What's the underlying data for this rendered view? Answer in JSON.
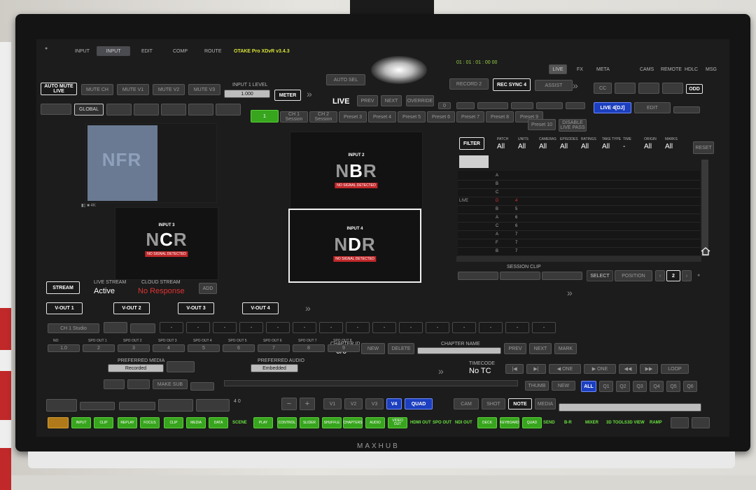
{
  "app": {
    "title": "OTAKE Pro XDvR v3.4.3",
    "brand": "MAXHUB"
  },
  "top_tabs": [
    "INPUT",
    "EDIT",
    "COMP",
    "ROUTE"
  ],
  "right_tabs": [
    "LIVE",
    "FX",
    "META",
    "CAMS",
    "REMOTE",
    "HDLC",
    "MSG"
  ],
  "header_buttons": {
    "auto_mute_live": "AUTO MUTE LIVE",
    "mute": [
      "MUTE CH",
      "MUTE V1",
      "MUTE V2",
      "MUTE V3"
    ],
    "input_level_label": "INPUT 1 LEVEL",
    "input_level": "1.000",
    "meter": "METER",
    "output": "LIVE",
    "prev": "PREV",
    "rec_sync": "REC SYNC",
    "rec_sync_val": "4",
    "assist": "ASSIST",
    "live_dj": "LIVE 4[DJ]",
    "edit": "EDIT",
    "global": "GLOBAL"
  },
  "rec_row": [
    "1",
    "CH 1 Session",
    "CH 2 Session",
    "Preset 3",
    "Preset 4",
    "Preset 5",
    "Preset 6",
    "Preset 7",
    "Preset 8",
    "Preset 9",
    "Preset 10",
    "DISABLE LIVE PASS"
  ],
  "monitors": [
    {
      "id": "NFR",
      "label": "",
      "nosig": ""
    },
    {
      "id": "NBR",
      "label": "INPUT 2",
      "nosig": "NO SIGNAL DETECTED",
      "hl": "B"
    },
    {
      "id": "NCR",
      "label": "INPUT 3",
      "nosig": "NO SIGNAL DETECTED",
      "hl": "C"
    },
    {
      "id": "NDR",
      "label": "INPUT 4",
      "nosig": "NO SIGNAL DETECTED",
      "hl": "D"
    }
  ],
  "filter": {
    "button": "FILTER",
    "columns": [
      {
        "h": "PATCH",
        "v": "All"
      },
      {
        "h": "UNITS",
        "v": "All"
      },
      {
        "h": "CAMERAS",
        "v": "All"
      },
      {
        "h": "EPISODES",
        "v": "All"
      },
      {
        "h": "RATINGS",
        "v": "All"
      },
      {
        "h": "TAKE TYPE",
        "v": "All"
      },
      {
        "h": "TIME",
        "v": "-"
      },
      {
        "h": "ORIGIN",
        "v": "All"
      },
      {
        "h": "MARKS",
        "v": "All"
      }
    ],
    "reset": "RESET"
  },
  "clip_rows": [
    {
      "c1": "",
      "c2": "A",
      "c3": ""
    },
    {
      "c1": "",
      "c2": "B",
      "c3": ""
    },
    {
      "c1": "",
      "c2": "C",
      "c3": ""
    },
    {
      "c1": "LIVE",
      "c2": "D",
      "c3": "4"
    },
    {
      "c1": "",
      "c2": "B",
      "c3": "5"
    },
    {
      "c1": "",
      "c2": "A",
      "c3": "6"
    },
    {
      "c1": "",
      "c2": "C",
      "c3": "6"
    },
    {
      "c1": "",
      "c2": "A",
      "c3": "7"
    },
    {
      "c1": "",
      "c2": "F",
      "c3": "7"
    },
    {
      "c1": "",
      "c2": "B",
      "c3": "7"
    }
  ],
  "session_clip": {
    "label": "SESSION CLIP",
    "select": "SELECT",
    "position": "POSITION",
    "page": "2"
  },
  "stream": {
    "button": "STREAM",
    "state_label": "LIVE STREAM",
    "state": "Active",
    "cloud_label": "CLOUD STREAM",
    "cloud": "No Response",
    "add": "ADD"
  },
  "vouts": [
    "V-OUT 1",
    "V-OUT 2",
    "V-OUT 3",
    "V-OUT 4"
  ],
  "slots": [
    "-",
    "-",
    "-",
    "-",
    "-",
    "-",
    "-",
    "-",
    "-",
    "-",
    "-",
    "-",
    "-",
    "-",
    "-"
  ],
  "sp_labels": [
    "NO",
    "SPO OUT 1",
    "SPO OUT 2",
    "SPO OUT 3",
    "SPO OUT 4",
    "SPO OUT 5",
    "SPO OUT 6",
    "SPO OUT 7",
    "SPO OUT 8"
  ],
  "sp_values": [
    "1.0",
    "2",
    "3",
    "4",
    "5",
    "6",
    "7",
    "8",
    "9"
  ],
  "preferred": {
    "media_label": "PREFERRED MEDIA",
    "media": "Recorded",
    "audio_label": "PREFERRED AUDIO",
    "audio": "Embedded",
    "chapter": "0/0",
    "chapter_label": "CHAPTER ID",
    "new": "NEW",
    "delete": "DELETE",
    "chapter_name": "CHAPTER NAME"
  },
  "transport": {
    "prev": "PREV",
    "next": "NEXT",
    "mark": "MARK",
    "timecode_label": "TIMECODE",
    "timecode": "No TC",
    "thumb": "THUMB",
    "new": "NEW"
  },
  "quad": {
    "all": "ALL",
    "buttons": [
      "Q1",
      "Q2",
      "Q3",
      "Q4",
      "Q5",
      "Q6"
    ]
  },
  "bottom_row": {
    "minus": "−",
    "plus": "+",
    "v_buttons": [
      "V1",
      "V2",
      "V3",
      "V4",
      "QUAD"
    ],
    "cam": "CAM",
    "shot": "SHOT",
    "note": "NOTE",
    "media": "MEDIA",
    "count": "4  0"
  },
  "fkeys": [
    "",
    "INPUT",
    "CLIP",
    "REPLAY",
    "FOCUS",
    "CLIP",
    "MEDIA",
    "DATA",
    "SCENE",
    "PLAY",
    "CONTROL",
    "SLIDER",
    "SHUFFLE",
    "CHAPTERS",
    "AUDIO",
    "VIDEO OUT",
    "HDMI OUT",
    "SPO OUT",
    "NDI OUT",
    "DECK",
    "KEYBOARD",
    "QUAD",
    "SEND",
    "B-R",
    "MIXER",
    "3D TOOLS",
    "3D VIEW",
    "RAMP"
  ]
}
